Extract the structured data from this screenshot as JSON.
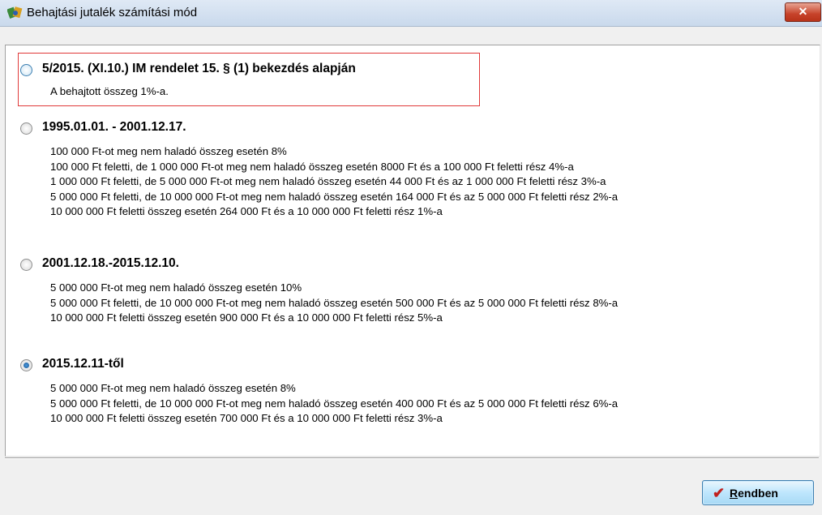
{
  "window": {
    "title": "Behajtási jutalék számítási mód",
    "close_label": "✕"
  },
  "options": [
    {
      "title": "5/2015. (XI.10.) IM rendelet 15. § (1) bekezdés alapján",
      "selected": false,
      "lines": [
        "A behajtott összeg 1%-a."
      ]
    },
    {
      "title": "1995.01.01. - 2001.12.17.",
      "selected": false,
      "lines": [
        "100 000 Ft-ot meg nem haladó összeg esetén 8%",
        "100 000 Ft feletti, de 1 000 000 Ft-ot meg nem haladó összeg esetén 8000 Ft és a 100 000 Ft feletti rész 4%-a",
        "1 000 000 Ft feletti, de 5 000 000 Ft-ot meg nem haladó összeg esetén 44 000 Ft és az 1 000 000 Ft feletti rész 3%-a",
        "5 000 000 Ft feletti, de 10 000 000 Ft-ot meg nem haladó összeg esetén 164 000 Ft és az 5 000 000 Ft feletti rész 2%-a",
        "10 000 000 Ft feletti összeg esetén 264 000 Ft és a 10 000 000 Ft feletti rész 1%-a"
      ]
    },
    {
      "title": "2001.12.18.-2015.12.10.",
      "selected": false,
      "lines": [
        "5 000 000 Ft-ot meg nem haladó összeg esetén 10%",
        "5 000 000 Ft feletti, de 10 000 000 Ft-ot meg nem haladó összeg esetén 500 000 Ft és az 5 000 000 Ft feletti rész 8%-a",
        "10 000 000 Ft feletti összeg esetén 900 000 Ft és a 10 000 000 Ft feletti rész 5%-a"
      ]
    },
    {
      "title": "2015.12.11-től",
      "selected": true,
      "lines": [
        "5 000 000 Ft-ot meg nem haladó összeg esetén 8%",
        "5 000 000 Ft feletti, de 10 000 000 Ft-ot meg nem haladó összeg esetén 400 000 Ft és az 5 000 000 Ft feletti rész 6%-a",
        "10 000 000 Ft feletti összeg esetén 700 000 Ft és a 10 000 000 Ft feletti rész 3%-a"
      ]
    }
  ],
  "ok_button": {
    "label": "Rendben",
    "icon": "checkmark-icon"
  },
  "colors": {
    "highlight": "#e03a3a",
    "checkmark": "#c0201e",
    "title_bar": "#c9d9ec"
  }
}
